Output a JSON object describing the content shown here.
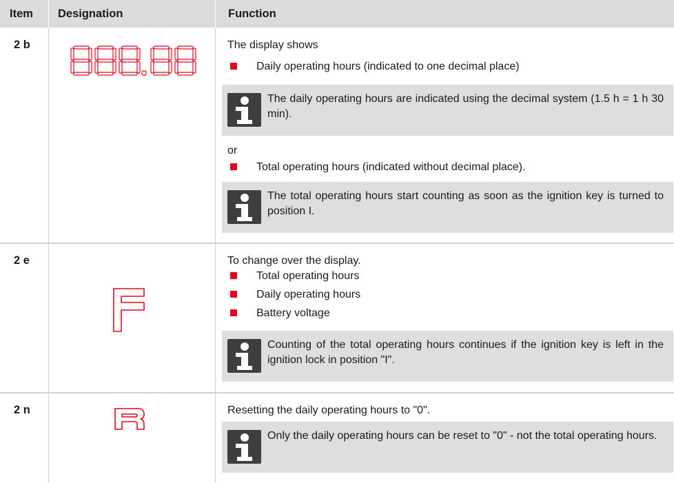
{
  "header": {
    "item": "Item",
    "designation": "Designation",
    "function": "Function"
  },
  "rows": [
    {
      "item": "2 b",
      "designation_icon": "seven-segment-display-888-88",
      "intro": "The display shows",
      "bullet1": "Daily operating hours (indicated to one decimal place)",
      "note1": "The daily operating hours are indicated using the decimal system (1.5 h = 1 h 30 min).",
      "or": "or",
      "bullet2": "Total operating hours (indicated without decimal place).",
      "note2": "The total operating hours start counting as soon as the ignition key is turned to position I."
    },
    {
      "item": "2 e",
      "designation_icon": "f-key-icon",
      "intro": "To change over the display.",
      "bullets": [
        "Total operating hours",
        "Daily operating hours",
        "Battery voltage"
      ],
      "note": "Counting of the total operating hours continues if the ignition key is left in the ignition lock in position \"I\"."
    },
    {
      "item": "2 n",
      "designation_icon": "r-key-icon",
      "intro": "Resetting the daily operating hours to \"0\".",
      "note": "Only the daily operating hours can be reset to \"0\" - not the total operating hours."
    }
  ],
  "colors": {
    "accent": "#e3071b",
    "note_bg": "#dedede",
    "header_bg": "#dcdcdc",
    "icon_bg": "#3e3e3e"
  }
}
